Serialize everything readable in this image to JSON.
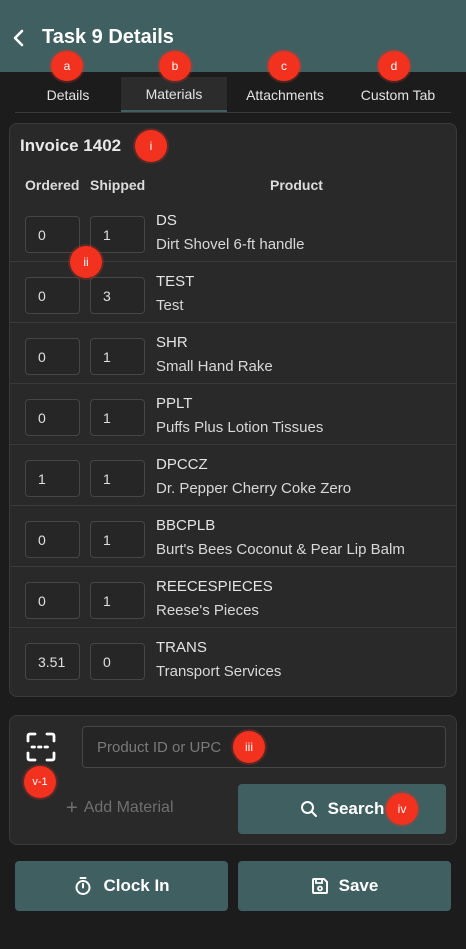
{
  "header": {
    "title": "Task 9 Details",
    "back_icon": "chevron-left-icon",
    "color": "#3f5f61"
  },
  "tabs": [
    {
      "label": "Details",
      "active": false,
      "marker": "a"
    },
    {
      "label": "Materials",
      "active": true,
      "marker": "b"
    },
    {
      "label": "Attachments",
      "active": false,
      "marker": "c"
    },
    {
      "label": "Custom Tab",
      "active": false,
      "marker": "d"
    }
  ],
  "invoice": {
    "title": "Invoice 1402",
    "marker": "i",
    "columns": {
      "ordered": "Ordered",
      "shipped": "Shipped",
      "product": "Product"
    },
    "qty_marker": "ii",
    "rows": [
      {
        "ordered": "0",
        "shipped": "1",
        "code": "DS",
        "name": "Dirt Shovel 6-ft handle"
      },
      {
        "ordered": "0",
        "shipped": "3",
        "code": "TEST",
        "name": "Test"
      },
      {
        "ordered": "0",
        "shipped": "1",
        "code": "SHR",
        "name": "Small Hand Rake"
      },
      {
        "ordered": "0",
        "shipped": "1",
        "code": "PPLT",
        "name": "Puffs Plus Lotion Tissues"
      },
      {
        "ordered": "1",
        "shipped": "1",
        "code": "DPCCZ",
        "name": "Dr. Pepper Cherry Coke Zero"
      },
      {
        "ordered": "0",
        "shipped": "1",
        "code": "BBCPLB",
        "name": "Burt's Bees Coconut & Pear Lip Balm"
      },
      {
        "ordered": "0",
        "shipped": "1",
        "code": "REECESPIECES",
        "name": "Reese's Pieces"
      },
      {
        "ordered": "3.51",
        "shipped": "0",
        "code": "TRANS",
        "name": "Transport Services"
      }
    ]
  },
  "material_search": {
    "scan_icon": "barcode-scan-icon",
    "scan_marker": "v-1",
    "placeholder": "Product ID or UPC",
    "value": "",
    "input_marker": "iii",
    "add_label": "Add Material",
    "search_label": "Search",
    "search_marker": "iv"
  },
  "footer": {
    "clock_in_label": "Clock In",
    "save_label": "Save"
  },
  "colors": {
    "accent": "#3f5f61",
    "marker": "#f2311f",
    "background": "#1c1c1c",
    "card": "#292929"
  }
}
